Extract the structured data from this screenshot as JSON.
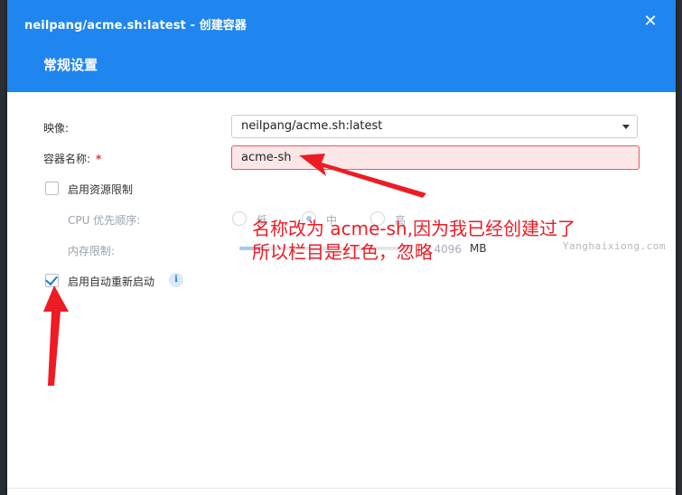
{
  "dialog": {
    "title": "neilpang/acme.sh:latest - 创建容器",
    "close_symbol": "✕",
    "tab_label": "常规设置"
  },
  "form": {
    "image_label": "映像:",
    "image_value": "neilpang/acme.sh:latest",
    "name_label": "容器名称:",
    "required_mark": "*",
    "name_value": "acme-sh",
    "resource_limit_label": "启用资源限制",
    "resource_limit_checked": false,
    "cpu_priority_label": "CPU 优先顺序:",
    "cpu_options": [
      "低",
      "中",
      "高"
    ],
    "cpu_selected": "中",
    "memory_label": "内存限制:",
    "memory_value": "4096",
    "memory_unit": "MB",
    "auto_restart_label": "启用自动重新启动",
    "auto_restart_checked": true,
    "info_symbol": "i"
  },
  "annotation": {
    "line1": "名称改为 acme-sh,因为我已经创建过了",
    "line2": "所以栏目是红色，忽略"
  },
  "watermark": "Yanghaixiong.com",
  "colors": {
    "accent": "#1f86f0",
    "error_border": "#e85a60",
    "error_bg": "#fbe7e8",
    "annotation_red": "#ee1b24"
  },
  "icons": [
    "close-icon",
    "dropdown-caret-icon",
    "check-icon",
    "info-icon",
    "arrow-icon"
  ]
}
